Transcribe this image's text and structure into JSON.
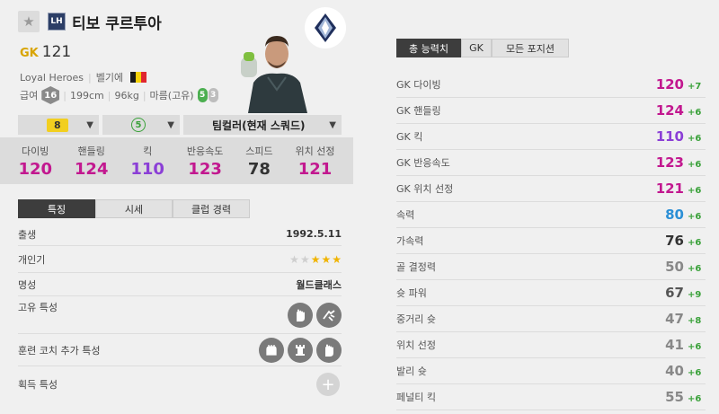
{
  "player": {
    "name": "티보 쿠르투아",
    "season_badge": "LH",
    "position": "GK",
    "overall": "121",
    "team": "Loyal Heroes",
    "nationality": "벨기에",
    "flag_colors": [
      "#1a1a1a",
      "#f5d10a",
      "#e0262f"
    ],
    "skill_grade": "16",
    "height": "199cm",
    "weight": "96kg",
    "body_type": "마름(고유)",
    "strong_foot": "5",
    "weak_foot": "3",
    "pay_label": "급여"
  },
  "selectors": {
    "upgrade_level": "8",
    "training": "5",
    "team_color": "팀컬러(현재 스쿼드)"
  },
  "summary_stats": [
    {
      "label": "다이빙",
      "value": "120",
      "color": "#c2188f"
    },
    {
      "label": "핸들링",
      "value": "124",
      "color": "#c2188f"
    },
    {
      "label": "킥",
      "value": "110",
      "color": "#8b3fd6"
    },
    {
      "label": "반응속도",
      "value": "123",
      "color": "#c2188f"
    },
    {
      "label": "스피드",
      "value": "78",
      "color": "#333333"
    },
    {
      "label": "위치 선정",
      "value": "121",
      "color": "#c2188f"
    }
  ],
  "left_tabs": [
    "특징",
    "시세",
    "클럽 경력"
  ],
  "details": {
    "birth_label": "출생",
    "birth_value": "1992.5.11",
    "skill_label": "개인기",
    "skill_stars_on": 3,
    "skill_stars_total": 5,
    "fame_label": "명성",
    "fame_value": "월드클래스",
    "unique_trait_label": "고유 특성",
    "coach_trait_label": "훈련 코치 추가 특성",
    "acquired_trait_label": "획득 특성"
  },
  "right_tabs": [
    "총 능력치",
    "GK",
    "모든 포지션"
  ],
  "attributes": [
    {
      "label": "GK 다이빙",
      "value": "120",
      "bonus": "+7",
      "color": "#c2188f"
    },
    {
      "label": "GK 핸들링",
      "value": "124",
      "bonus": "+6",
      "color": "#c2188f"
    },
    {
      "label": "GK 킥",
      "value": "110",
      "bonus": "+6",
      "color": "#8b3fd6"
    },
    {
      "label": "GK 반응속도",
      "value": "123",
      "bonus": "+6",
      "color": "#c2188f"
    },
    {
      "label": "GK 위치 선정",
      "value": "121",
      "bonus": "+6",
      "color": "#c2188f"
    },
    {
      "label": "속력",
      "value": "80",
      "bonus": "+6",
      "color": "#2b8fd6"
    },
    {
      "label": "가속력",
      "value": "76",
      "bonus": "+6",
      "color": "#333333"
    },
    {
      "label": "골 결정력",
      "value": "50",
      "bonus": "+6",
      "color": "#888888"
    },
    {
      "label": "슛 파워",
      "value": "67",
      "bonus": "+9",
      "color": "#555555"
    },
    {
      "label": "중거리 슛",
      "value": "47",
      "bonus": "+8",
      "color": "#888888"
    },
    {
      "label": "위치 선정",
      "value": "41",
      "bonus": "+6",
      "color": "#888888"
    },
    {
      "label": "발리 슛",
      "value": "40",
      "bonus": "+6",
      "color": "#888888"
    },
    {
      "label": "페널티 킥",
      "value": "55",
      "bonus": "+6",
      "color": "#888888"
    }
  ]
}
